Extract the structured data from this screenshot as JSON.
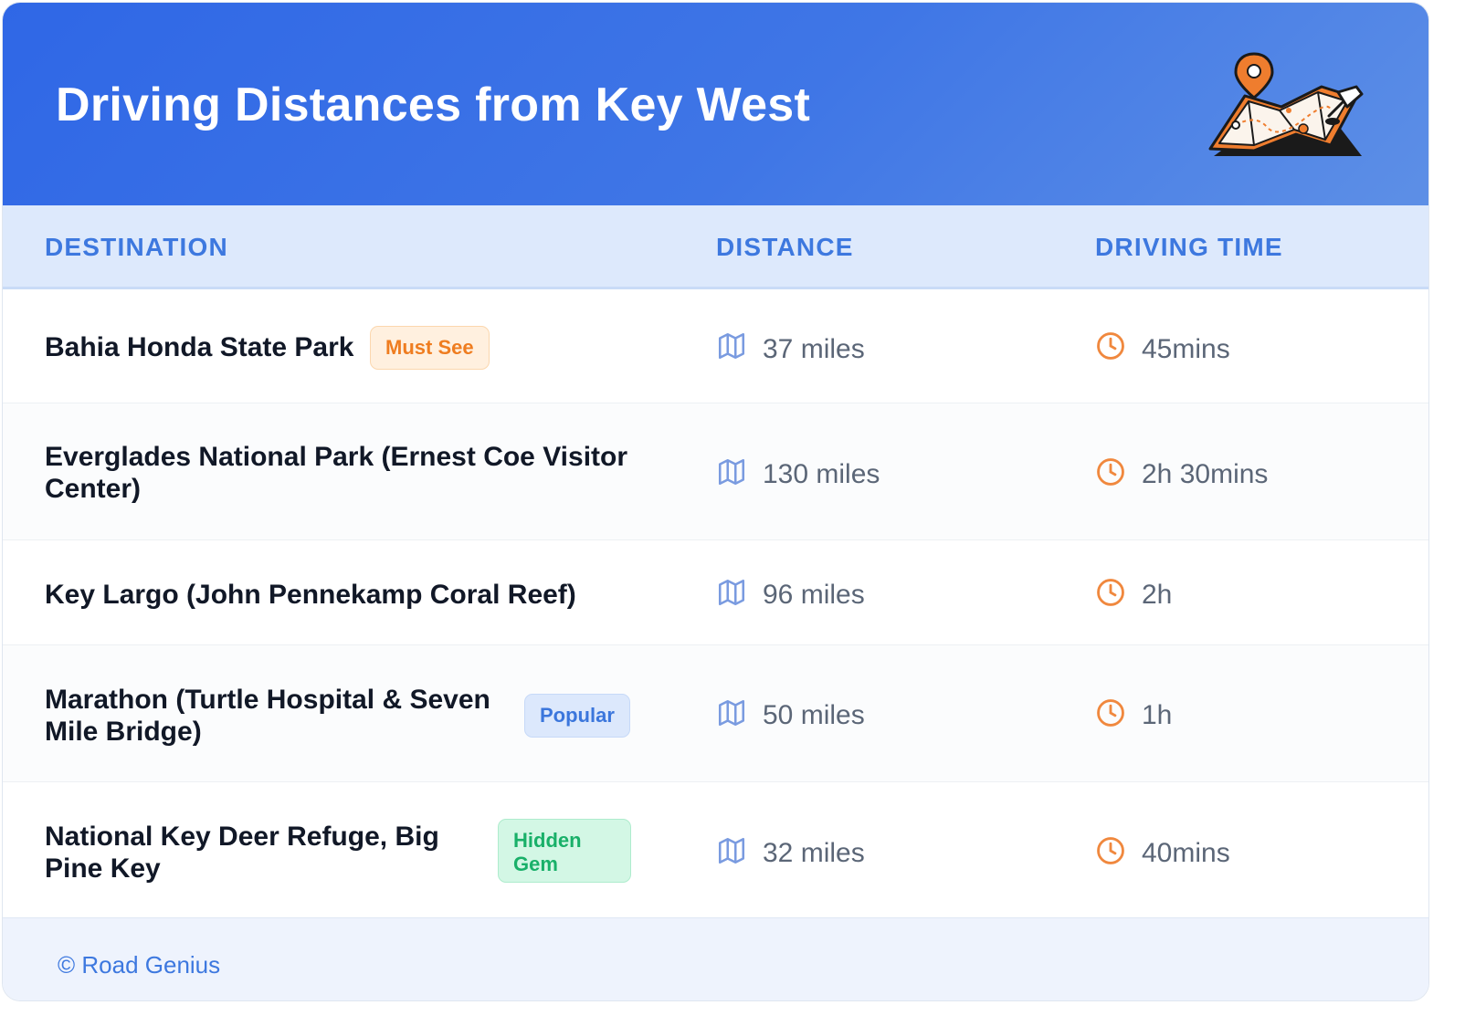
{
  "header": {
    "title": "Driving Distances from Key West",
    "illustration": "map-with-pins-icon",
    "gradient_colors": [
      "#2f67e6",
      "#5d8fe6"
    ]
  },
  "table": {
    "columns": {
      "destination": "DESTINATION",
      "distance": "DISTANCE",
      "driving_time": "DRIVING TIME"
    },
    "rows": [
      {
        "destination": "Bahia Honda State Park",
        "badge": "Must See",
        "badge_color": "orange",
        "distance": "37 miles",
        "driving_time": "45mins"
      },
      {
        "destination": "Everglades National Park (Ernest Coe Visitor Center)",
        "badge": "",
        "badge_color": "",
        "distance": "130 miles",
        "driving_time": "2h 30mins"
      },
      {
        "destination": "Key Largo (John Pennekamp Coral Reef)",
        "badge": "",
        "badge_color": "",
        "distance": "96 miles",
        "driving_time": "2h"
      },
      {
        "destination": "Marathon (Turtle Hospital & Seven Mile Bridge)",
        "badge": "Popular",
        "badge_color": "blue",
        "distance": "50 miles",
        "driving_time": "1h"
      },
      {
        "destination": "National Key Deer Refuge, Big Pine Key",
        "badge": "Hidden Gem",
        "badge_color": "green",
        "distance": "32 miles",
        "driving_time": "40mins"
      }
    ],
    "distance_icon": "map-icon",
    "time_icon": "clock-icon"
  },
  "footer": {
    "credit": "© Road Genius"
  },
  "colors": {
    "accent": "#3d78df",
    "clock": "#f0883e",
    "map_icon": "#7a9be0"
  }
}
